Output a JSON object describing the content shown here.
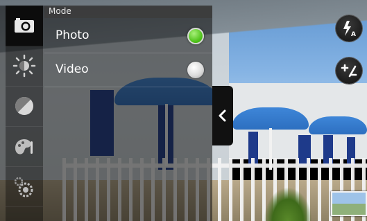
{
  "app": "Camera",
  "mode_menu": {
    "header": "Mode",
    "options": [
      {
        "label": "Photo",
        "selected": true
      },
      {
        "label": "Video",
        "selected": false
      }
    ]
  },
  "toolbar": {
    "items": [
      {
        "name": "camera-mode",
        "icon": "camera-icon",
        "active": true
      },
      {
        "name": "brightness",
        "icon": "brightness-icon",
        "active": false
      },
      {
        "name": "color-effect",
        "icon": "color-effect-icon",
        "active": false
      },
      {
        "name": "scene-mode",
        "icon": "palette-icon",
        "active": false
      },
      {
        "name": "settings",
        "icon": "settings-gear-icon",
        "active": false
      }
    ]
  },
  "right_controls": {
    "flash": {
      "icon": "flash-auto-icon"
    },
    "exposure": {
      "icon": "exposure-plus-minus-icon"
    },
    "gallery_thumbnail": {
      "icon": "gallery-thumbnail"
    }
  },
  "colors": {
    "radio_selected": "#4fc21a",
    "panel_bg": "#0f0f0f"
  }
}
